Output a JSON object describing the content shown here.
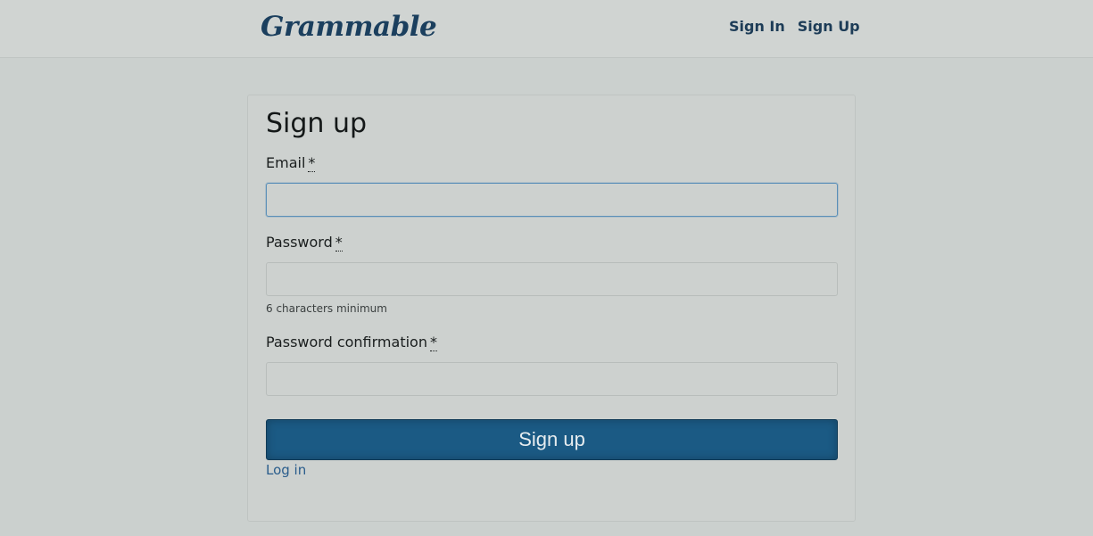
{
  "navbar": {
    "brand": "Grammable",
    "links": [
      "Sign In",
      "Sign Up"
    ]
  },
  "form": {
    "title": "Sign up",
    "required_mark": "*",
    "email": {
      "label": "Email",
      "value": "",
      "placeholder": ""
    },
    "password": {
      "label": "Password",
      "value": "",
      "placeholder": "",
      "hint": "6 characters minimum"
    },
    "password_confirmation": {
      "label": "Password confirmation",
      "value": "",
      "placeholder": ""
    },
    "submit_label": "Sign up",
    "login_link": "Log in"
  },
  "colors": {
    "background": "#cbd0ce",
    "brand": "#1b3f5e",
    "button": "#1b5a84",
    "link": "#2a5d8c",
    "focus_border": "#5a8fb8"
  }
}
